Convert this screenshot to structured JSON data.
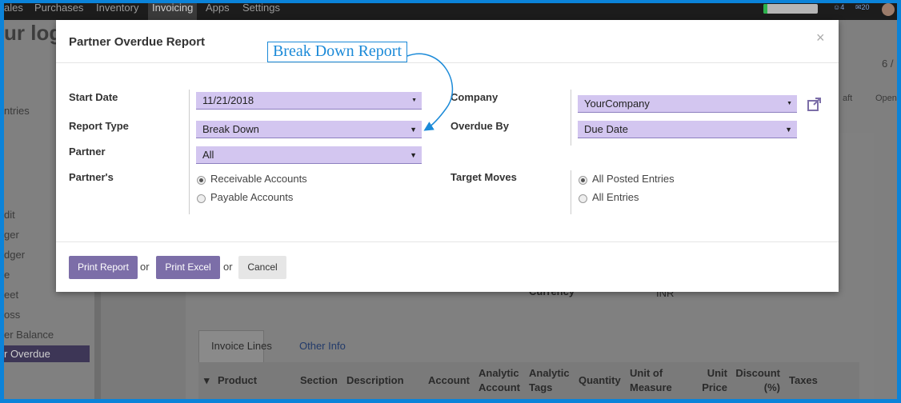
{
  "topbar": {
    "menus": [
      "ales",
      "Purchases",
      "Inventory",
      "Invoicing",
      "Apps",
      "Settings"
    ],
    "active_menu": "Invoicing",
    "badge_1": "4",
    "badge_2": "20"
  },
  "background": {
    "title": "ur log",
    "sidebar_items": [
      "ntries",
      "dit",
      "ger",
      "dger",
      "e",
      "eet",
      "oss",
      "er Balance",
      "r Overdue"
    ],
    "pager": "6 /",
    "status_steps": [
      "aft",
      "Open"
    ],
    "currency_label": "Currency",
    "currency_value": "INR",
    "tabs": [
      "Invoice Lines",
      "Other Info"
    ],
    "columns": [
      "Product",
      "Section",
      "Description",
      "Account",
      "Analytic Account",
      "Analytic Tags",
      "Quantity",
      "Unit of Measure",
      "Unit Price",
      "Discount (%)",
      "Taxes"
    ]
  },
  "modal": {
    "title": "Partner Overdue Report",
    "close_glyph": "×",
    "callout": "Break Down Report",
    "start_date_label": "Start Date",
    "start_date_value": "11/21/2018",
    "report_type_label": "Report Type",
    "report_type_value": "Break Down",
    "partner_label": "Partner",
    "partner_value": "All",
    "partners_label": "Partner's",
    "partner_options": [
      "Receivable Accounts",
      "Payable Accounts"
    ],
    "partner_selected": "Receivable Accounts",
    "company_label": "Company",
    "company_value": "YourCompany",
    "overdue_by_label": "Overdue By",
    "overdue_by_value": "Due Date",
    "target_moves_label": "Target Moves",
    "target_options": [
      "All Posted Entries",
      "All Entries"
    ],
    "target_selected": "All Posted Entries",
    "print_report_label": "Print Report",
    "print_excel_label": "Print Excel",
    "cancel_label": "Cancel",
    "or_label": "or"
  },
  "colors": {
    "field_bg": "#d3c6f0",
    "primary_button": "#7c6ea8",
    "callout": "#1b8ad8"
  }
}
